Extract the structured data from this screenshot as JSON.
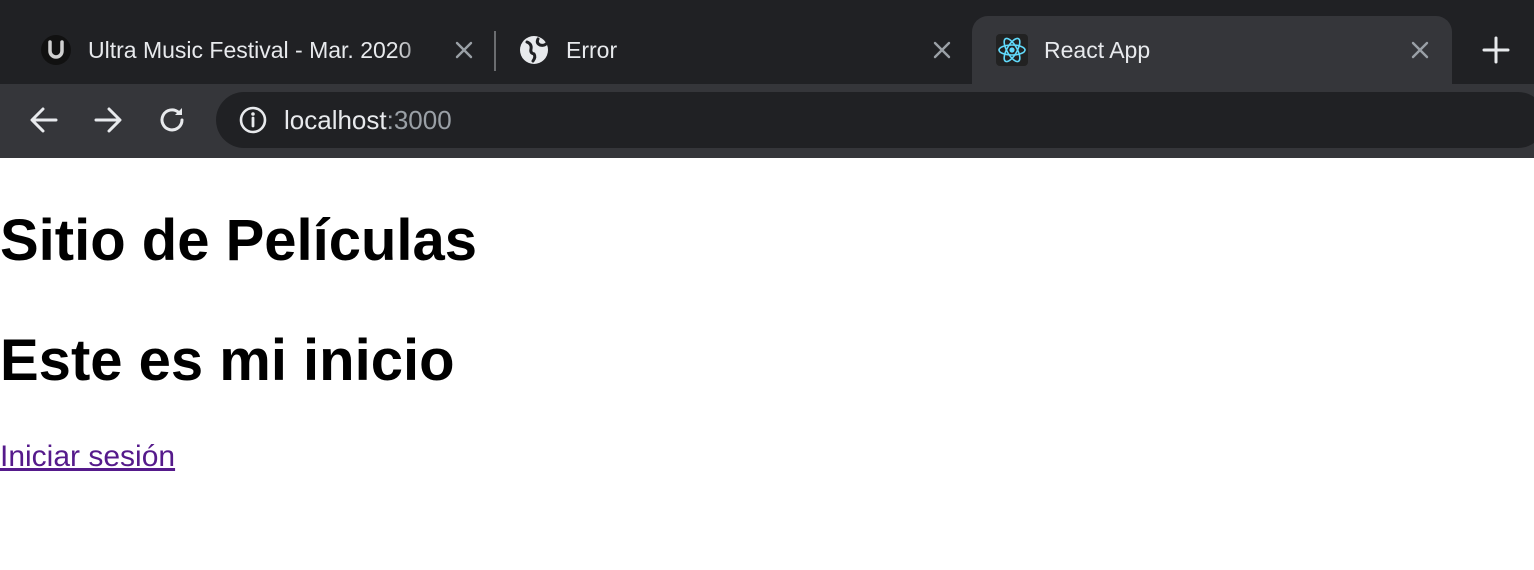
{
  "tabs": [
    {
      "title": "Ultra Music Festival - Mar. 2020",
      "favicon": "ultra-logo-icon",
      "active": false
    },
    {
      "title": "Error",
      "favicon": "globe-icon",
      "active": false
    },
    {
      "title": "React App",
      "favicon": "react-icon",
      "active": true
    }
  ],
  "new_tab": {
    "icon": "plus-icon"
  },
  "toolbar": {
    "back_icon": "arrow-left-icon",
    "forward_icon": "arrow-right-icon",
    "reload_icon": "reload-icon",
    "site_info_icon": "info-icon",
    "url_host": "localhost",
    "url_port": ":3000"
  },
  "page": {
    "title": "Sitio de Películas",
    "subtitle": "Este es mi inicio",
    "login_link": "Iniciar sesión"
  },
  "colors": {
    "chrome_dark": "#202124",
    "chrome_active": "#35363a",
    "link_visited": "#551a8b",
    "react_blue": "#61dafb"
  }
}
